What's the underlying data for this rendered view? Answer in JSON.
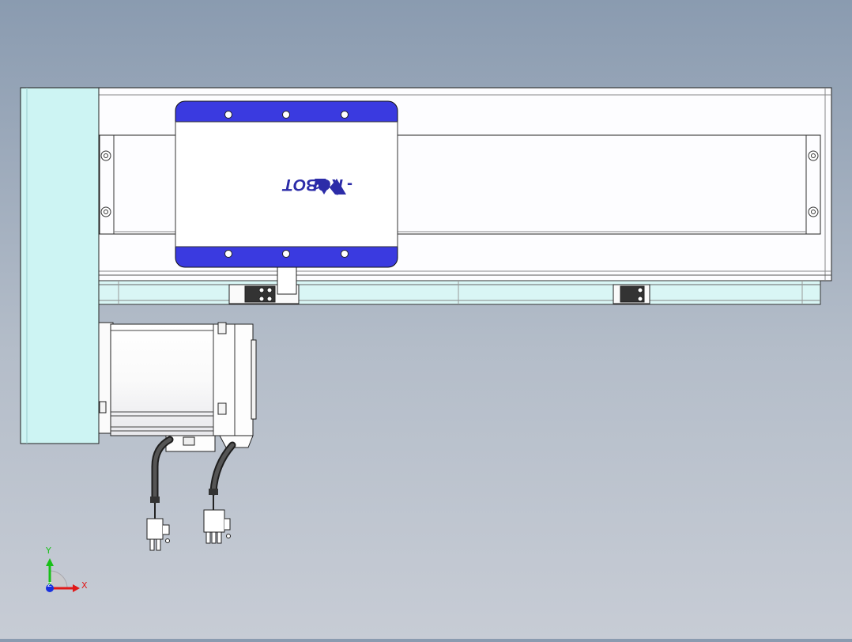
{
  "logo": {
    "brand_text": "ROBOT",
    "registered_mark": "®"
  },
  "triad": {
    "x_label": "X",
    "y_label": "Y",
    "z_label": "Z"
  },
  "colors": {
    "background_top": "#8a9bb0",
    "background_bottom": "#c7ccd5",
    "end_cap": "#cdf4f3",
    "rail_body": "#fdfdff",
    "carriage_band": "#3a3ae0",
    "carriage_panel": "#ffffff",
    "motor_body": "#ffffff",
    "cable": "#1e1e1e",
    "axis_x": "#e01818",
    "axis_y": "#18c018",
    "axis_z": "#1830e0"
  },
  "icons": {
    "origin": "coordinate-triad-icon",
    "logo": "robot-logo-icon"
  }
}
